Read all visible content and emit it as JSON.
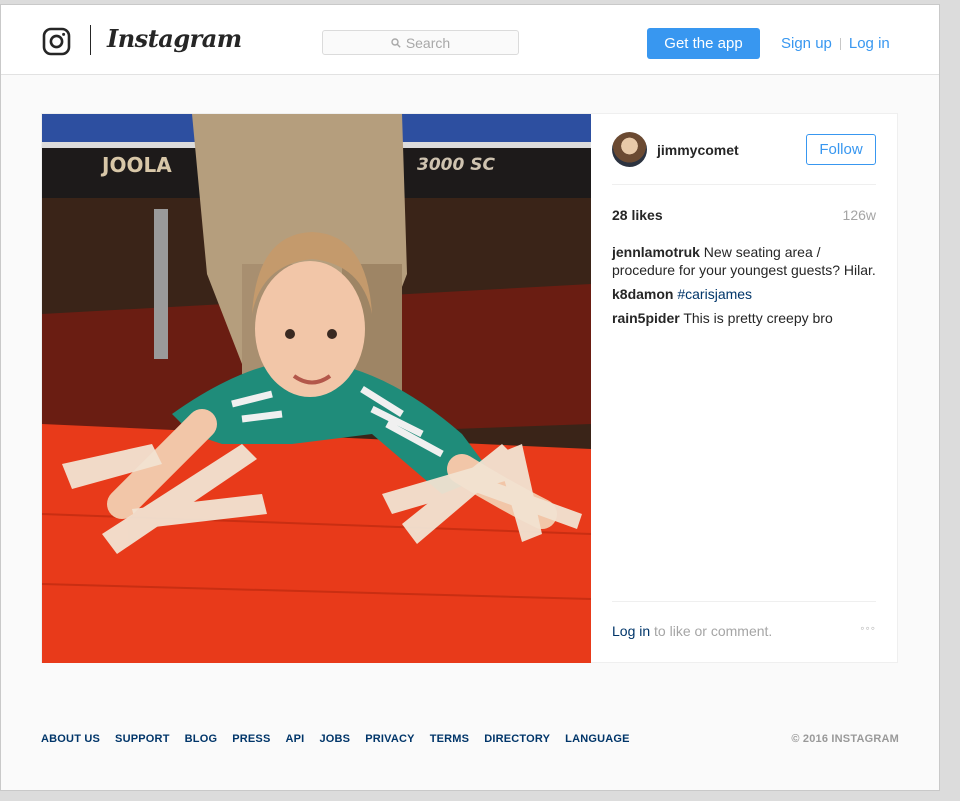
{
  "header": {
    "brand": "Instagram",
    "search_placeholder": "Search",
    "get_app_label": "Get the app",
    "signup_label": "Sign up",
    "login_label": "Log in"
  },
  "post": {
    "username": "jimmycomet",
    "follow_label": "Follow",
    "likes": "28 likes",
    "age": "126w",
    "comments": [
      {
        "user": "jennlamotruk",
        "text": "New seating area / procedure for your youngest guests? Hilar."
      },
      {
        "user": "k8damon",
        "text": "#carisjames"
      },
      {
        "user": "rain5pider",
        "text": "This is pretty creepy bro"
      }
    ],
    "login_link": "Log in",
    "login_suffix": " to like or comment.",
    "more_label": "◦◦◦",
    "photo_text": {
      "brand_left": "JOOLA",
      "brand_right": "3000 SC"
    }
  },
  "footer": {
    "links": [
      "ABOUT US",
      "SUPPORT",
      "BLOG",
      "PRESS",
      "API",
      "JOBS",
      "PRIVACY",
      "TERMS",
      "DIRECTORY",
      "LANGUAGE"
    ],
    "copyright": "© 2016 INSTAGRAM"
  },
  "colors": {
    "accent": "#3897f0",
    "link": "#003569",
    "muted": "#a5a5a5"
  }
}
